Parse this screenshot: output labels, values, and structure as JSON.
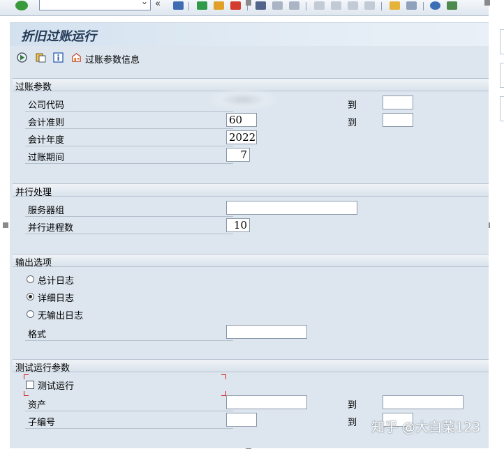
{
  "window": {
    "title": "折旧过账运行"
  },
  "app_toolbar": {
    "posting_param_info_label": "过账参数信息"
  },
  "groups": {
    "posting": {
      "title": "过账参数",
      "company_code_label": "公司代码",
      "company_code_to_label": "到",
      "accounting_principle_label": "会计准则",
      "accounting_principle_value": "60",
      "accounting_principle_to_label": "到",
      "fiscal_year_label": "会计年度",
      "fiscal_year_value": "2022",
      "posting_period_label": "过账期间",
      "posting_period_value": "7"
    },
    "parallel": {
      "title": "并行处理",
      "server_group_label": "服务器组",
      "server_group_value": "",
      "parallel_processes_label": "并行进程数",
      "parallel_processes_value": "10"
    },
    "output": {
      "title": "输出选项",
      "options": [
        {
          "label": "总计日志",
          "selected": false
        },
        {
          "label": "详细日志",
          "selected": true
        },
        {
          "label": "无输出日志",
          "selected": false
        }
      ],
      "format_label": "格式",
      "format_value": ""
    },
    "test": {
      "title": "测试运行参数",
      "test_run_label": "测试运行",
      "test_run_checked": false,
      "asset_label": "资产",
      "asset_to_label": "到",
      "sub_number_label": "子编号",
      "sub_number_to_label": "到"
    }
  },
  "watermark": "知乎 @大白菜123",
  "colors": {
    "panel": "#dde6ef",
    "header": "#d3e1ef",
    "title_text": "#233a57",
    "focus": "#d21b1b"
  }
}
